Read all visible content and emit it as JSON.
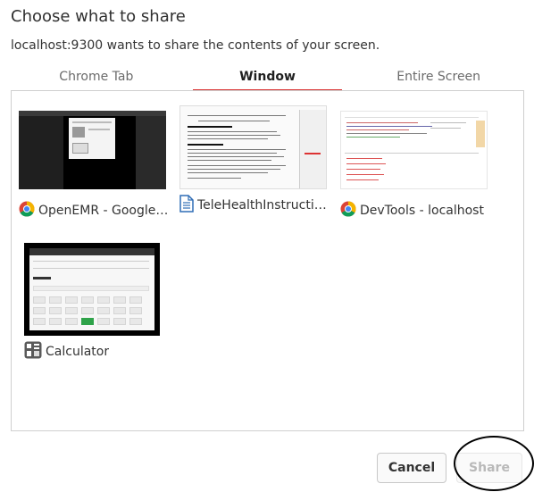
{
  "dialog": {
    "title": "Choose what to share",
    "subtitle": "localhost:9300 wants to share the contents of your screen."
  },
  "tabs": [
    {
      "label": "Chrome Tab",
      "active": false
    },
    {
      "label": "Window",
      "active": true
    },
    {
      "label": "Entire Screen",
      "active": false
    }
  ],
  "windows": [
    {
      "label": "OpenEMR - Google Chrome",
      "icon": "chrome-icon"
    },
    {
      "label": "TeleHealthInstructions",
      "icon": "document-icon"
    },
    {
      "label": "DevTools - localhost",
      "icon": "chrome-icon"
    },
    {
      "label": "Calculator",
      "icon": "calculator-icon"
    }
  ],
  "buttons": {
    "cancel": "Cancel",
    "share": "Share"
  },
  "colors": {
    "accent": "#d9302f",
    "disabled_text": "#b9b9b9"
  }
}
